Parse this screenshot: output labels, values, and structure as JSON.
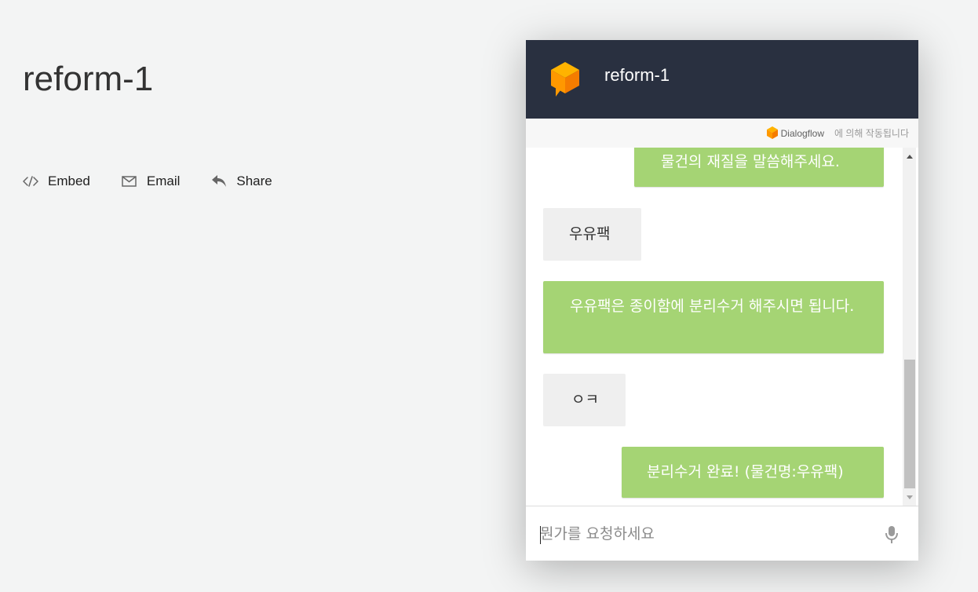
{
  "page": {
    "title": "reform-1"
  },
  "actions": [
    {
      "label": "Embed",
      "icon": "code-icon"
    },
    {
      "label": "Email",
      "icon": "envelope-icon"
    },
    {
      "label": "Share",
      "icon": "reply-arrow-icon"
    }
  ],
  "chat": {
    "agent_name": "reform-1",
    "powered_by": {
      "brand": "Dialogflow",
      "suffix": "에 의해 작동됩니다"
    },
    "messages": [
      {
        "from": "bot",
        "text": "물건의 재질을 말씀해주세요."
      },
      {
        "from": "user",
        "text": "우유팩"
      },
      {
        "from": "bot",
        "text": "우유팩은 종이함에 분리수거 해주시면 됩니다."
      },
      {
        "from": "user",
        "text": "ㅇㅋ"
      },
      {
        "from": "bot",
        "text": "분리수거 완료! (물건명:우유팩)"
      }
    ],
    "input": {
      "placeholder": "뭔가를 요청하세요",
      "value": ""
    }
  },
  "colors": {
    "header_bg": "#293040",
    "bot_bubble": "#a5d474",
    "user_bubble": "#efefef",
    "logo_orange": "#ff9800"
  }
}
